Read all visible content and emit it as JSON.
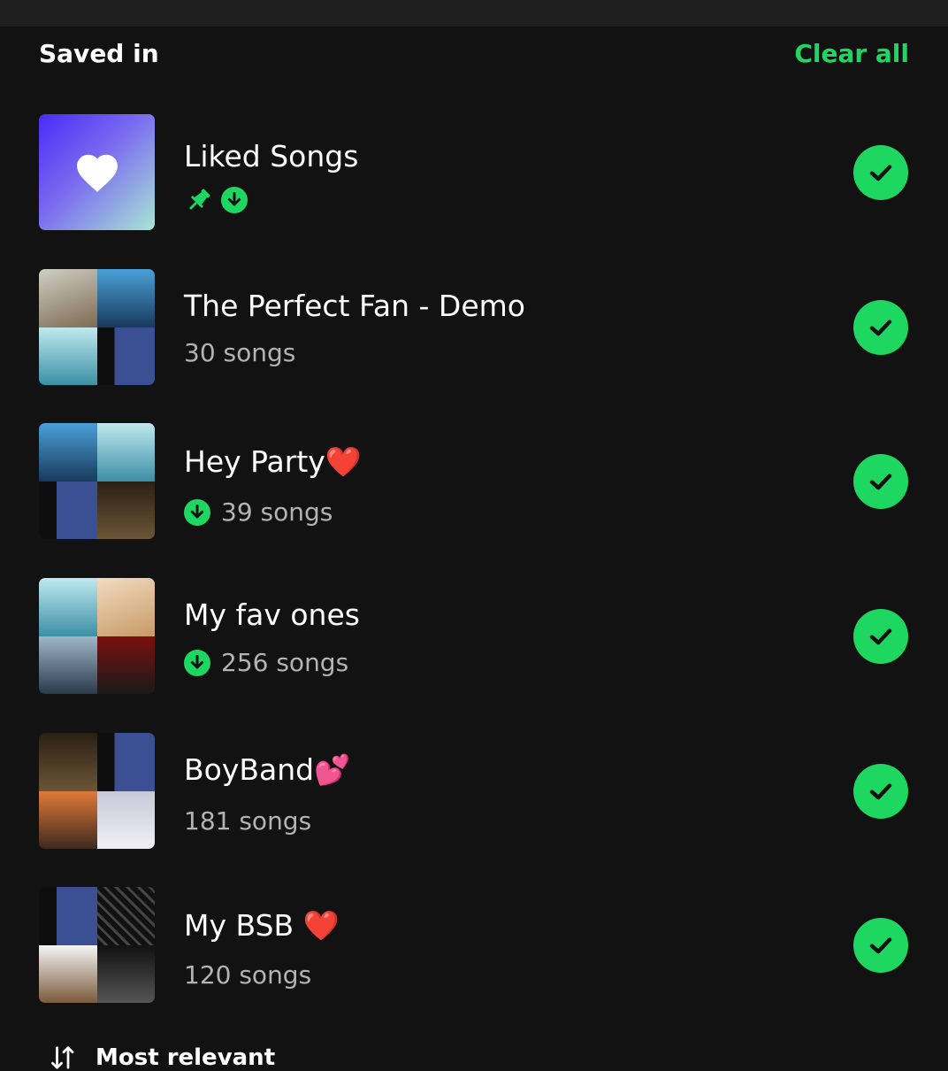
{
  "header": {
    "title": "Saved in",
    "clear_all": "Clear all"
  },
  "colors": {
    "accent": "#1ed760",
    "background": "#121212",
    "secondary_text": "#b3b3b3"
  },
  "playlists": [
    {
      "name": "Liked Songs",
      "meta": "",
      "pinned": true,
      "downloaded": true,
      "checked": true
    },
    {
      "name": "The Perfect Fan - Demo",
      "meta": "30 songs",
      "pinned": false,
      "downloaded": false,
      "checked": true
    },
    {
      "name": "Hey Party❤️",
      "meta": "39 songs",
      "pinned": false,
      "downloaded": true,
      "checked": true
    },
    {
      "name": "My fav ones",
      "meta": "256 songs",
      "pinned": false,
      "downloaded": true,
      "checked": true
    },
    {
      "name": "BoyBand💕",
      "meta": "181 songs",
      "pinned": false,
      "downloaded": false,
      "checked": true
    },
    {
      "name": "My BSB ❤️",
      "meta": "120 songs",
      "pinned": false,
      "downloaded": false,
      "checked": true
    }
  ],
  "sort": {
    "label": "Most relevant",
    "icon": "sort-arrows-icon"
  }
}
